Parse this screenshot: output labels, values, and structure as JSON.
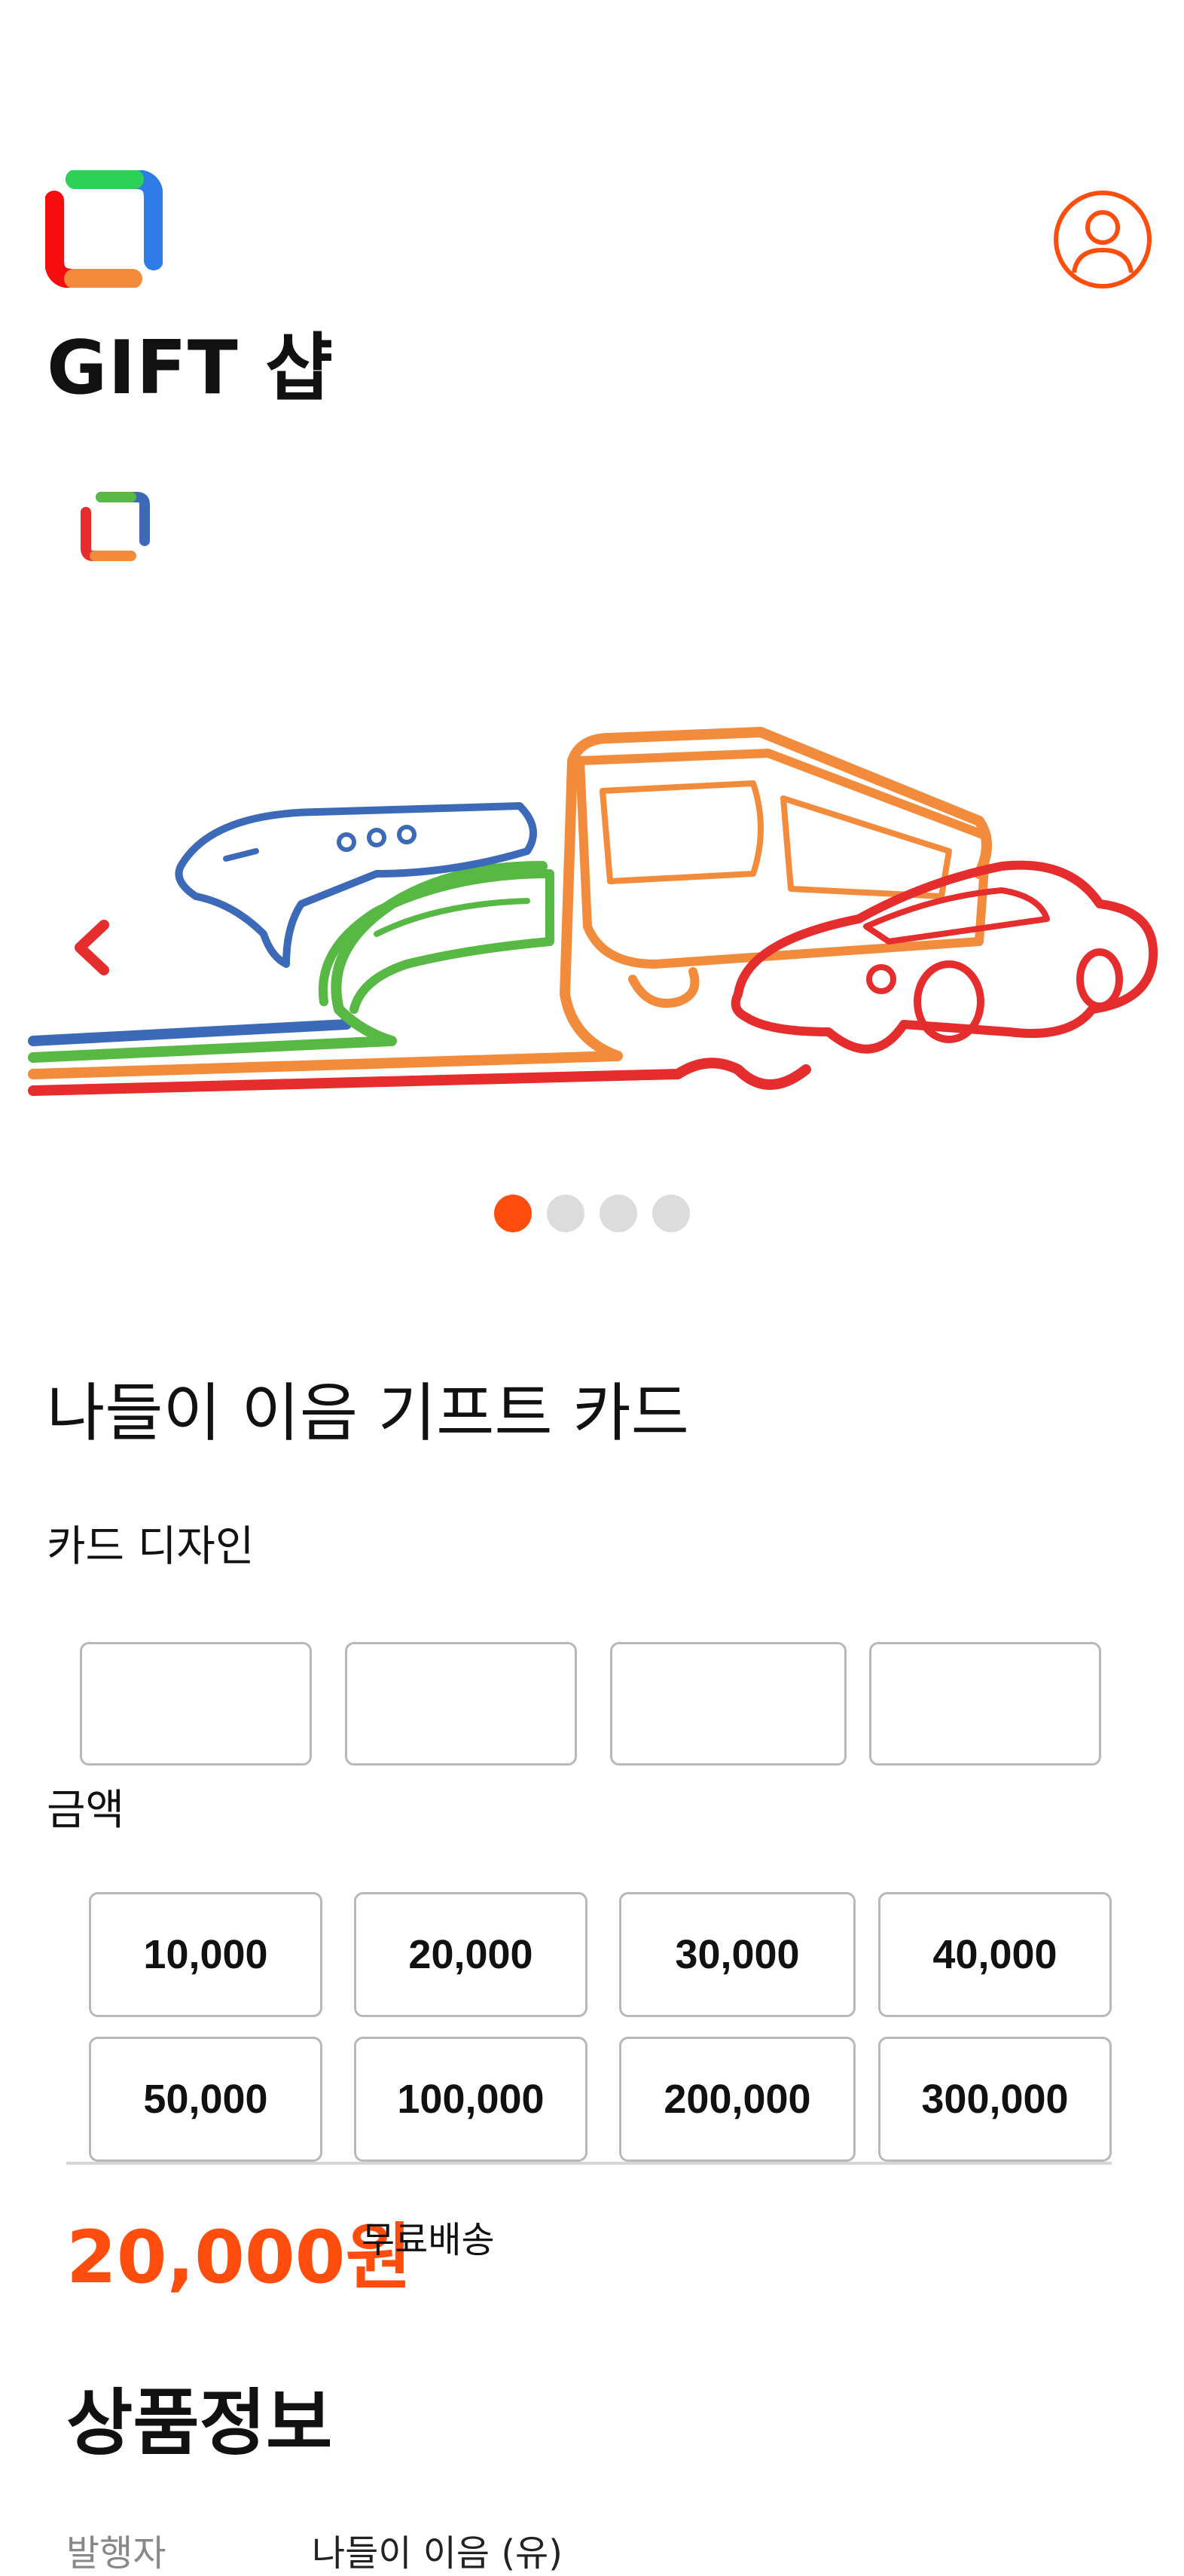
{
  "header": {
    "title": "GIFT 샵"
  },
  "product": {
    "name": "나들이 이음 기프트 카드"
  },
  "design": {
    "label": "카드 디자인",
    "options": [
      "",
      "",
      "",
      ""
    ]
  },
  "amount": {
    "label": "금액",
    "options": [
      "10,000",
      "20,000",
      "30,000",
      "40,000",
      "50,000",
      "100,000",
      "200,000",
      "300,000"
    ]
  },
  "price": {
    "value": "20,000원",
    "shipping": "무료배송"
  },
  "product_info": {
    "title": "상품정보",
    "rows": [
      {
        "label": "발행자",
        "value": "나들이 이음 (유)"
      }
    ]
  },
  "carousel": {
    "current_index": 1,
    "total": 4
  },
  "colors": {
    "accent": "#ff4d0d",
    "brand_red": "#e52d2d",
    "brand_orange": "#f28b3c",
    "brand_green": "#57b944",
    "brand_blue": "#3c6ab8"
  }
}
